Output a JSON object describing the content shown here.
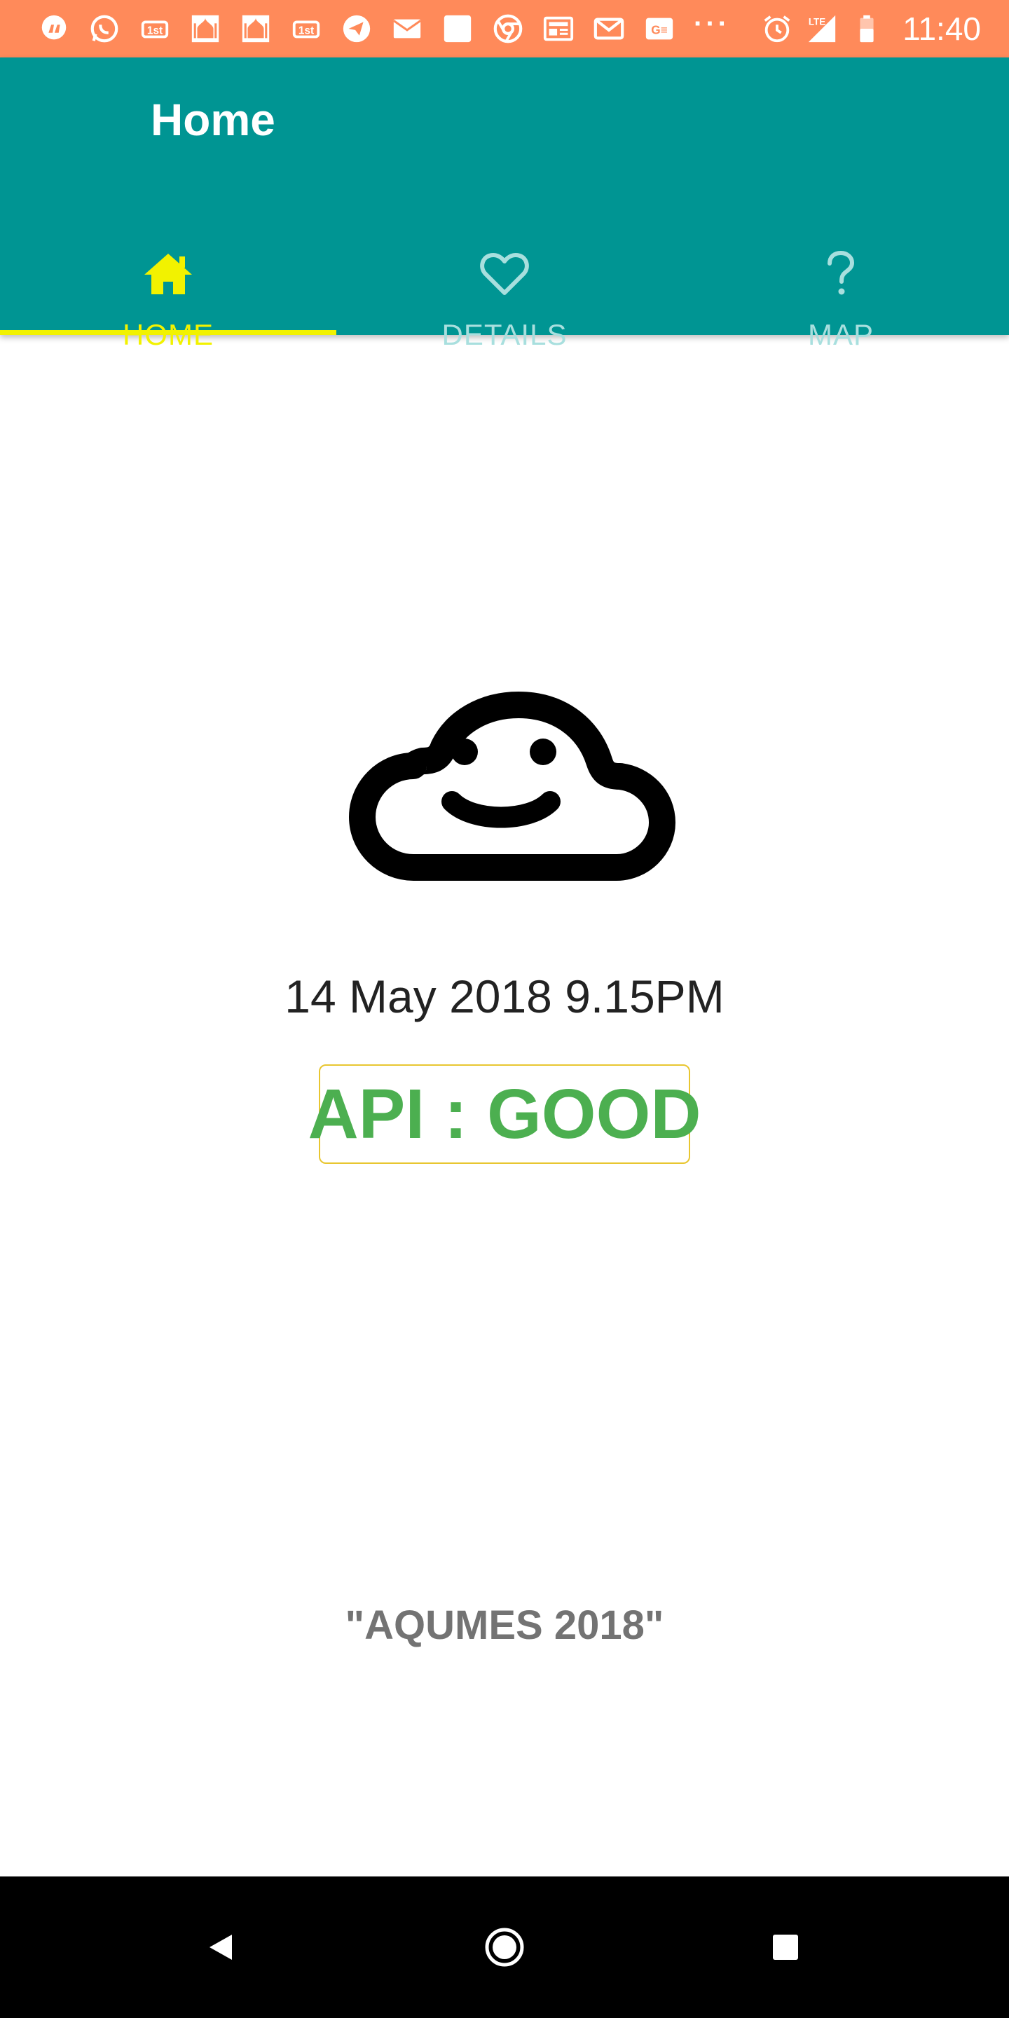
{
  "status_bar": {
    "time": "11:40",
    "network": "LTE",
    "background_color": "#FF8A5A",
    "notification_icons": [
      "quote-icon",
      "whatsapp-icon",
      "app-icon",
      "mosque-icon",
      "mosque-icon",
      "app-icon",
      "telegram-icon",
      "mail-icon",
      "square-icon",
      "chrome-icon",
      "news-icon",
      "gmail-icon",
      "gdelivery-icon",
      "more-dots-icon"
    ],
    "more_dots": "···"
  },
  "app_bar": {
    "title": "Home",
    "background_color": "#009593"
  },
  "tabs": [
    {
      "label": "HOME",
      "icon": "home-icon",
      "active": true
    },
    {
      "label": "DETAILS",
      "icon": "heart-icon",
      "active": false
    },
    {
      "label": "MAP",
      "icon": "question-icon",
      "active": false
    }
  ],
  "main": {
    "status_icon": "happy-cloud-icon",
    "datetime": "14 May 2018 9.15PM",
    "api_status": "API : GOOD",
    "api_status_color": "#4CAF50",
    "footer": "\"AQUMES 2018\""
  },
  "nav_bar": {
    "buttons": [
      "back-icon",
      "home-circle-icon",
      "recents-icon"
    ]
  }
}
